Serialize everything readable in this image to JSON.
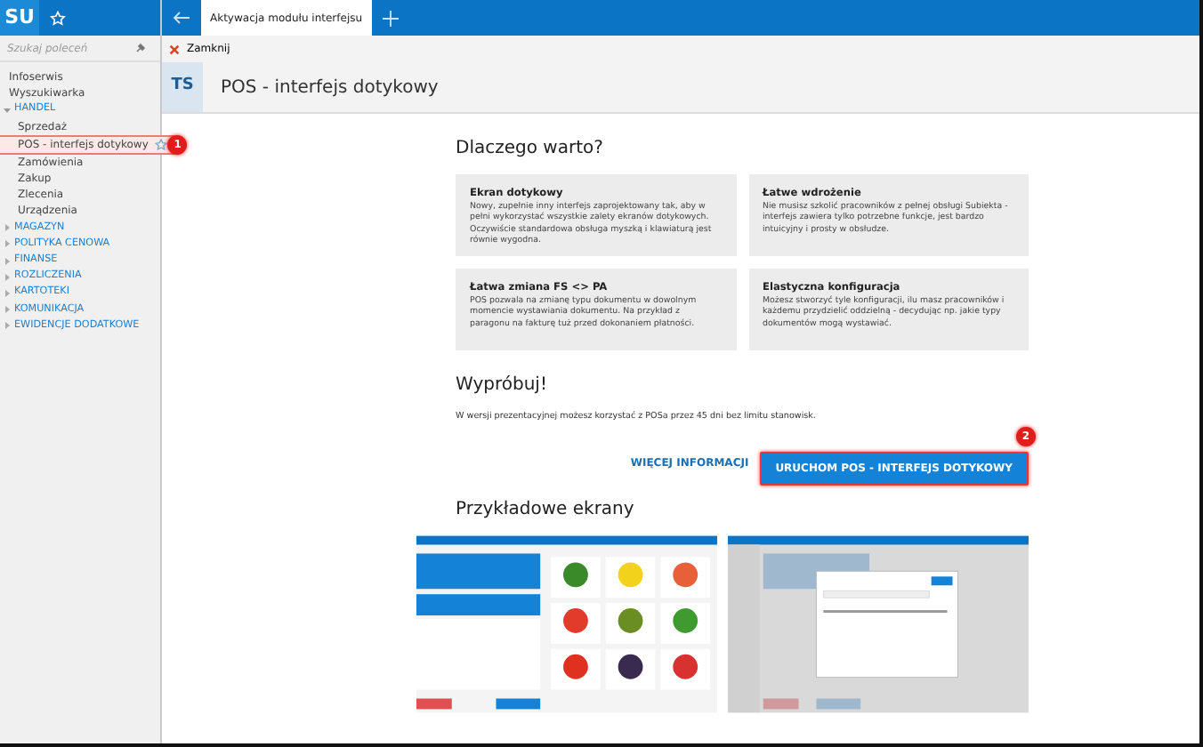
{
  "app": {
    "logo": "SU"
  },
  "sidebar": {
    "search": {
      "placeholder": "Szukaj poleceń"
    },
    "items": [
      {
        "label": "Infoserwis",
        "kind": "link",
        "selected": false
      },
      {
        "label": "Wyszukiwarka",
        "kind": "link",
        "selected": false
      },
      {
        "label": "HANDEL",
        "kind": "group",
        "expanded": true,
        "children": [
          {
            "label": "Sprzedaż",
            "selected": false
          },
          {
            "label": "POS - interfejs dotykowy",
            "selected": true,
            "starred": false,
            "callout": "1"
          },
          {
            "label": "Zamówienia",
            "selected": false
          },
          {
            "label": "Zakup",
            "selected": false
          },
          {
            "label": "Zlecenia",
            "selected": false
          },
          {
            "label": "Urządzenia",
            "selected": false
          }
        ]
      },
      {
        "label": "MAGAZYN",
        "kind": "group",
        "expanded": false
      },
      {
        "label": "POLITYKA CENOWA",
        "kind": "group",
        "expanded": false
      },
      {
        "label": "FINANSE",
        "kind": "group",
        "expanded": false
      },
      {
        "label": "ROZLICZENIA",
        "kind": "group",
        "expanded": false
      },
      {
        "label": "KARTOTEKI",
        "kind": "group",
        "expanded": false
      },
      {
        "label": "KOMUNIKACJA",
        "kind": "group",
        "expanded": false
      },
      {
        "label": "EWIDENCJE DODATKOWE",
        "kind": "group",
        "expanded": false
      }
    ]
  },
  "tabs": [
    {
      "label": "Aktywacja modułu interfejsu",
      "selected": true
    }
  ],
  "toolbar": {
    "close": "Zamknij"
  },
  "header": {
    "badge": "TS",
    "title": "POS - interfejs dotykowy"
  },
  "content": {
    "why_title": "Dlaczego warto?",
    "features": [
      {
        "title": "Ekran dotykowy",
        "text": "Nowy, zupełnie inny interfejs zaprojektowany tak, aby w pełni wykorzystać wszystkie zalety ekranów dotykowych. Oczywiście standardowa obsługa myszką i klawiaturą jest równie wygodna."
      },
      {
        "title": "Łatwe wdrożenie",
        "text": "Nie musisz szkolić pracowników z pełnej obsługi Subiekta - interfejs zawiera tylko potrzebne funkcje, jest bardzo intuicyjny i prosty w obsłudze."
      },
      {
        "title": "Łatwa zmiana FS <> PA",
        "text": "POS pozwala na zmianę typu dokumentu w dowolnym momencie wystawiania dokumentu. Na przykład z paragonu na fakturę tuż przed dokonaniem płatności."
      },
      {
        "title": "Elastyczna konfiguracja",
        "text": "Możesz stworzyć tyle konfiguracji, ilu masz pracowników i każdemu przydzielić oddzielną - decydując np. jakie typy dokumentów mogą wystawiać."
      }
    ],
    "try_title": "Wypróbuj!",
    "try_text": "W wersji prezentacyjnej możesz korzystać z POSa przez 45 dni bez limitu stanowisk.",
    "more_link": "WIĘCEJ INFORMACJI",
    "launch_button": {
      "label": "URUCHOM POS - INTERFEJS DOTYKOWY",
      "callout": "2"
    },
    "screens_title": "Przykładowe ekrany",
    "screens": [
      {
        "kind": "products"
      },
      {
        "kind": "dialog"
      }
    ]
  }
}
